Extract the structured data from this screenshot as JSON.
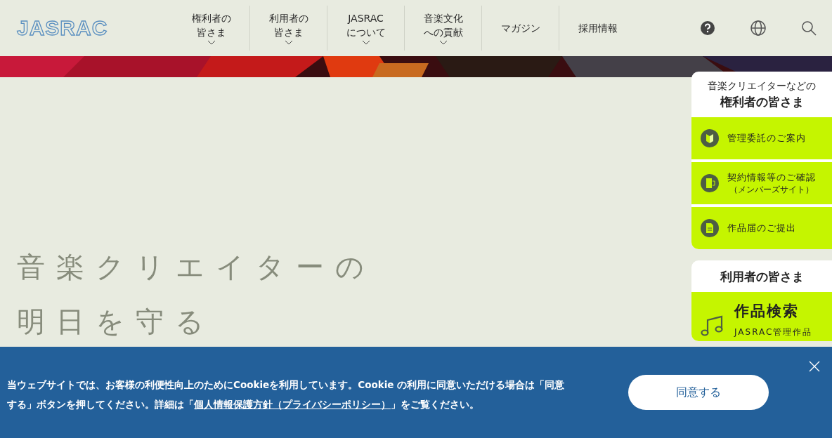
{
  "header": {
    "logo": "JASRAC",
    "nav": [
      {
        "label": "権利者の皆さま",
        "has_menu": true
      },
      {
        "label": "利用者の皆さま",
        "has_menu": true
      },
      {
        "label": "JASRACについて",
        "has_menu": true
      },
      {
        "label": "音楽文化への貢献",
        "has_menu": true
      },
      {
        "label": "マガジン",
        "has_menu": false
      },
      {
        "label": "採用情報",
        "has_menu": false
      }
    ],
    "tools": [
      {
        "kind": "help"
      },
      {
        "kind": "language"
      },
      {
        "kind": "search"
      }
    ]
  },
  "hero": {
    "image": {
      "kind": "picture"
    },
    "headline": [
      "音楽クリエイターの",
      "明日を守る"
    ]
  },
  "sidebar": [
    {
      "subtitle": "音楽クリエイターなどの",
      "title": "権利者の皆さま",
      "items": [
        {
          "kind": "beginner",
          "label": "管理委託のご案内"
        },
        {
          "kind": "door",
          "label": "契約情報等のご確認",
          "note": "（メンバーズサイト）"
        },
        {
          "kind": "document",
          "label": "作品届のご提出"
        }
      ]
    },
    {
      "title": "利用者の皆さま",
      "items": [
        {
          "kind": "music",
          "label": "作品検索",
          "note": "JASRAC管理作品"
        }
      ]
    }
  ],
  "cookie_banner": {
    "text": "当ウェブサイトでは、お客様の利便性向上のためにCookieを利用しています。Cookie の利用に同意いただける場合は「同意する」ボタンを押してください。詳細は「",
    "link": "個人情報保護方針（プライバシーポリシー）",
    "text_after": "」をご覧ください。",
    "accept": "同意する"
  }
}
